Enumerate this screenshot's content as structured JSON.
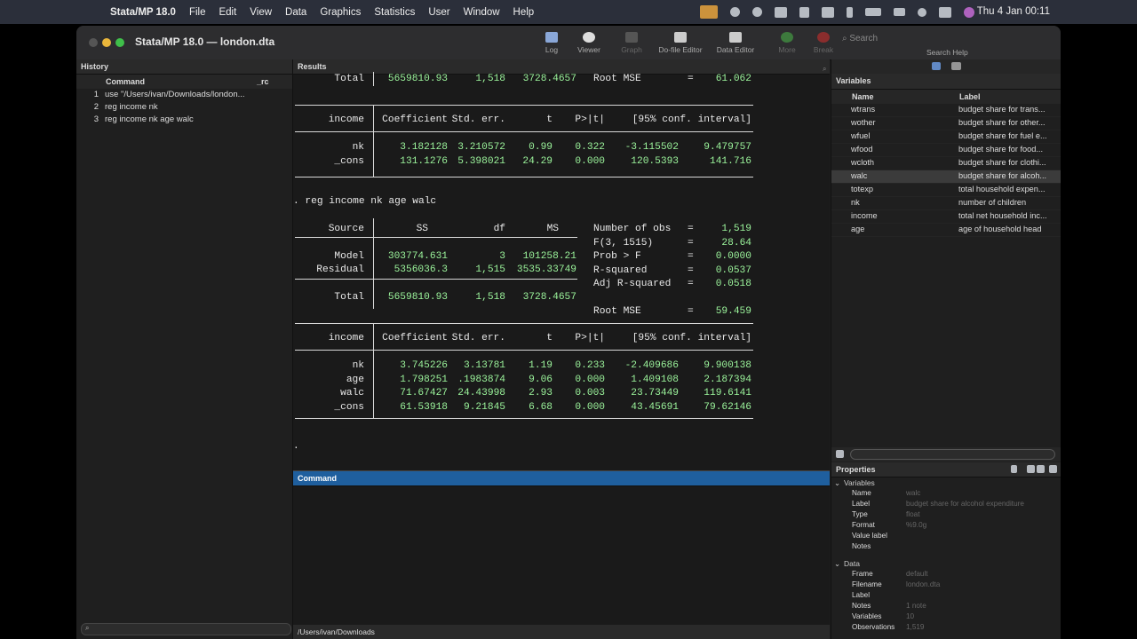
{
  "menubar": {
    "app": "Stata/MP 18.0",
    "items": [
      "File",
      "Edit",
      "View",
      "Data",
      "Graphics",
      "Statistics",
      "User",
      "Window",
      "Help"
    ],
    "clock": "Thu 4 Jan  00:11"
  },
  "window": {
    "title": "Stata/MP 18.0 — london.dta",
    "toolbar": [
      {
        "label": "Log"
      },
      {
        "label": "Viewer"
      },
      {
        "label": "Graph"
      },
      {
        "label": "Do-file Editor"
      },
      {
        "label": "Data Editor"
      },
      {
        "label": "More"
      },
      {
        "label": "Break"
      }
    ],
    "search_placeholder": "Search",
    "search_help": "Search Help"
  },
  "history": {
    "title": "History",
    "col_command": "Command",
    "col_rc": "_rc",
    "items": [
      {
        "n": "1",
        "cmd": "use \"/Users/ivan/Downloads/london..."
      },
      {
        "n": "2",
        "cmd": "reg income nk"
      },
      {
        "n": "3",
        "cmd": "reg income nk age walc"
      }
    ]
  },
  "results": {
    "title": "Results",
    "top_total": {
      "label": "Total",
      "ss": "5659810.93",
      "df": "1,518",
      "ms": "3728.4657",
      "stat": "Root MSE",
      "eq": "=",
      "val": "61.062"
    },
    "coef_header": {
      "dep": "income",
      "c1": "Coefficient",
      "c2": "Std. err.",
      "c3": "t",
      "c4": "P>|t|",
      "c5": "[95% conf. interval]"
    },
    "reg1_rows": [
      {
        "var": "nk",
        "v": [
          "3.182128",
          "3.210572",
          "0.99",
          "0.322",
          "-3.115502",
          "9.479757"
        ]
      },
      {
        "var": "_cons",
        "v": [
          "131.1276",
          "5.398021",
          "24.29",
          "0.000",
          "120.5393",
          "141.716"
        ]
      }
    ],
    "command2": ". reg income nk age walc",
    "anova_header": {
      "source": "Source",
      "ss": "SS",
      "df": "df",
      "ms": "MS"
    },
    "anova_rows": [
      {
        "label": "Model",
        "ss": "303774.631",
        "df": "3",
        "ms": "101258.21"
      },
      {
        "label": "Residual",
        "ss": "5356036.3",
        "df": "1,515",
        "ms": "3535.33749"
      },
      {
        "label": "Total",
        "ss": "5659810.93",
        "df": "1,518",
        "ms": "3728.4657"
      }
    ],
    "stats": [
      {
        "k": "Number of obs",
        "v": "1,519"
      },
      {
        "k": "F(3, 1515)",
        "v": "28.64"
      },
      {
        "k": "Prob > F",
        "v": "0.0000"
      },
      {
        "k": "R-squared",
        "v": "0.0537"
      },
      {
        "k": "Adj R-squared",
        "v": "0.0518"
      },
      {
        "k": "Root MSE",
        "v": "59.459"
      }
    ],
    "reg2_rows": [
      {
        "var": "nk",
        "v": [
          "3.745226",
          "3.13781",
          "1.19",
          "0.233",
          "-2.409686",
          "9.900138"
        ]
      },
      {
        "var": "age",
        "v": [
          "1.798251",
          ".1983874",
          "9.06",
          "0.000",
          "1.409108",
          "2.187394"
        ]
      },
      {
        "var": "walc",
        "v": [
          "71.67427",
          "24.43998",
          "2.93",
          "0.003",
          "23.73449",
          "119.6141"
        ]
      },
      {
        "var": "_cons",
        "v": [
          "61.53918",
          "9.21845",
          "6.68",
          "0.000",
          "43.45691",
          "79.62146"
        ]
      }
    ],
    "prompt": "."
  },
  "command": {
    "title": "Command"
  },
  "statusbar": {
    "path": "/Users/ivan/Downloads"
  },
  "variables": {
    "title": "Variables",
    "col_name": "Name",
    "col_label": "Label",
    "items": [
      {
        "name": "wtrans",
        "label": "budget share for trans..."
      },
      {
        "name": "wother",
        "label": "budget share for other..."
      },
      {
        "name": "wfuel",
        "label": "budget share for fuel e..."
      },
      {
        "name": "wfood",
        "label": "budget share for food..."
      },
      {
        "name": "wcloth",
        "label": "budget share for clothi..."
      },
      {
        "name": "walc",
        "label": "budget share for alcoh..."
      },
      {
        "name": "totexp",
        "label": "total household expen..."
      },
      {
        "name": "nk",
        "label": "number of children"
      },
      {
        "name": "income",
        "label": "total net household inc..."
      },
      {
        "name": "age",
        "label": "age of household head"
      }
    ]
  },
  "properties": {
    "title": "Properties",
    "variables_section": "Variables",
    "var_props": [
      {
        "k": "Name",
        "v": "walc"
      },
      {
        "k": "Label",
        "v": "budget share for alcohol expenditure"
      },
      {
        "k": "Type",
        "v": "float"
      },
      {
        "k": "Format",
        "v": "%9.0g"
      },
      {
        "k": "Value label",
        "v": ""
      },
      {
        "k": "Notes",
        "v": ""
      }
    ],
    "data_section": "Data",
    "data_props": [
      {
        "k": "Frame",
        "v": "default"
      },
      {
        "k": "Filename",
        "v": "london.dta"
      },
      {
        "k": "Label",
        "v": ""
      },
      {
        "k": "Notes",
        "v": "1 note"
      },
      {
        "k": "Variables",
        "v": "10"
      },
      {
        "k": "Observations",
        "v": "1,519"
      }
    ]
  }
}
